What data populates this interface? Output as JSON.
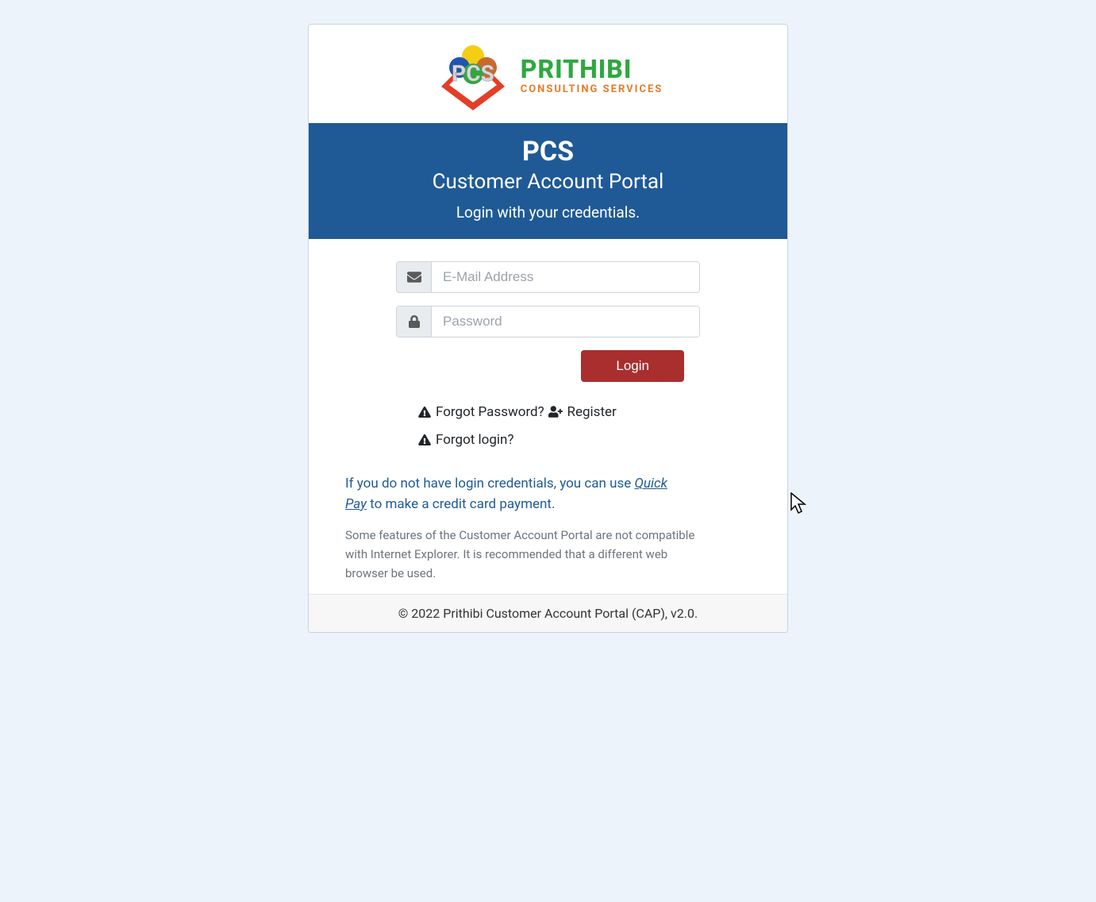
{
  "logo": {
    "brand": "PRITHIBI",
    "tagline": "CONSULTING SERVICES",
    "mark_text": "PCS"
  },
  "header": {
    "title": "PCS",
    "subtitle": "Customer Account Portal",
    "tagline": "Login with your credentials."
  },
  "form": {
    "email_placeholder": "E-Mail Address",
    "password_placeholder": "Password",
    "login_button": "Login"
  },
  "links": {
    "forgot_password": "Forgot Password?",
    "register": "Register",
    "forgot_login": "Forgot login?"
  },
  "info": {
    "quickpay_prefix": "If you do not have login credentials, you can use ",
    "quickpay_link": "Quick Pay",
    "quickpay_suffix": " to make a credit card payment.",
    "compat_notice": "Some features of the Customer Account Portal are not compatible with Internet Explorer. It is recommended that a different web browser be used."
  },
  "footer": {
    "copyright_prefix": "© 2022 ",
    "copyright_link": "Prithibi Customer Account Portal (CAP), v2.0."
  }
}
